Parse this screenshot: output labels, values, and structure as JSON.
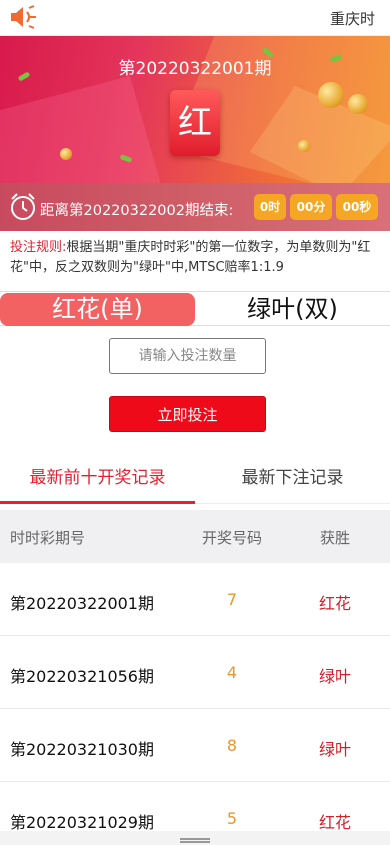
{
  "header": {
    "marquee_text": "重庆时"
  },
  "banner": {
    "period_title": "第20220322001期",
    "result": "红"
  },
  "countdown": {
    "label": "距离第20220322002期结束:",
    "hours": "0时",
    "minutes": "00分",
    "seconds": "00秒"
  },
  "rules": {
    "label": "投注规则:",
    "text": "根据当期\"重庆时时彩\"的第一位数字，为单数则为\"红花\"中，反之双数则为\"绿叶\"中,MTSC赔率1:1.9"
  },
  "options": {
    "red": "红花(单)",
    "green": "绿叶(双)",
    "selected": "红花(单)"
  },
  "form": {
    "qty_placeholder": "请输入投注数量",
    "qty_value": "",
    "submit_label": "立即投注"
  },
  "tabs": [
    {
      "label": "最新前十开奖记录",
      "active": true
    },
    {
      "label": "最新下注记录",
      "active": false
    }
  ],
  "table": {
    "headers": [
      "时时彩期号",
      "开奖号码",
      "获胜"
    ],
    "rows": [
      {
        "period": "第20220322001期",
        "number": "7",
        "winner": "红花"
      },
      {
        "period": "第20220321056期",
        "number": "4",
        "winner": "绿叶"
      },
      {
        "period": "第20220321030期",
        "number": "8",
        "winner": "绿叶"
      },
      {
        "period": "第20220321029期",
        "number": "5",
        "winner": "红花"
      }
    ]
  },
  "colors": {
    "accent_red": "#e0242f",
    "number_orange": "#e9962e",
    "countdown_box": "#f5a623"
  },
  "icons": {
    "speaker": "speaker-icon",
    "clock": "alarm-clock-icon"
  }
}
